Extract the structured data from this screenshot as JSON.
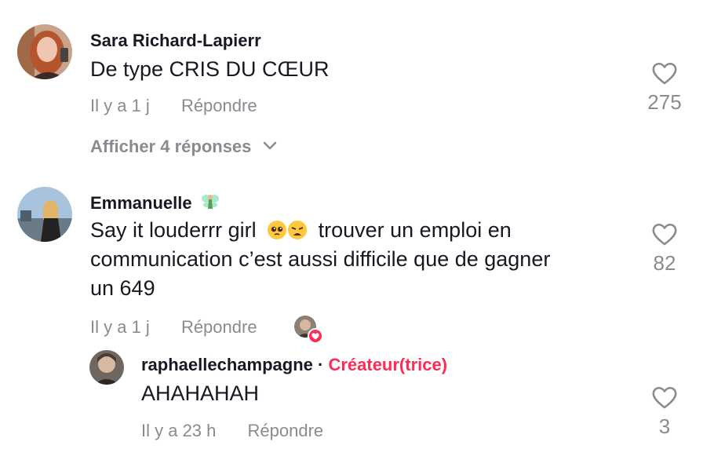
{
  "comments": [
    {
      "username": "Sara Richard-Lapierr",
      "text": "De type CRIS DU CŒUR",
      "time": "Il y a 1 j",
      "reply": "Répondre",
      "likes": "275",
      "view_replies": "Afficher 4 réponses"
    },
    {
      "username": "Emmanuelle",
      "text_line1_a": "Say it louderrr girl",
      "text_line1_b": "trouver un emploi en",
      "text_line2": "communication c’est aussi difficile que de gagner",
      "text_line3": "un 649",
      "time": "Il y a 1 j",
      "reply": "Répondre",
      "likes": "82",
      "username_emoji_icon": "fairy-icon",
      "emojis": [
        "pleading-face",
        "weary-face"
      ]
    }
  ],
  "reply": {
    "username": "raphaellechampagne",
    "separator": "·",
    "creator_label": "Créateur(trice)",
    "text": "AHAHAHAH",
    "time": "Il y a 23 h",
    "reply": "Répondre",
    "likes": "3"
  },
  "colors": {
    "creator_accent": "#fe2c55",
    "meta_gray": "#8a8b91",
    "text": "#161823"
  }
}
